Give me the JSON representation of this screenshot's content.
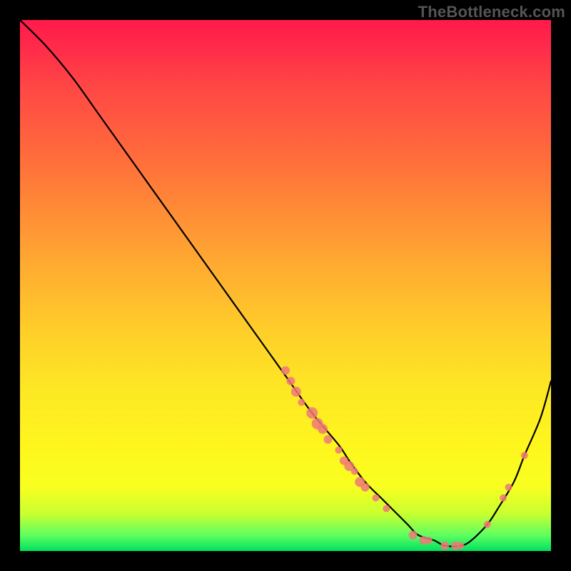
{
  "watermark": "TheBottleneck.com",
  "colors": {
    "background": "#000000",
    "gradient_top": "#ff1a4a",
    "gradient_bottom": "#00e060",
    "curve": "#000000",
    "dots": "#f07878"
  },
  "chart_data": {
    "type": "line",
    "title": "",
    "xlabel": "",
    "ylabel": "",
    "xlim": [
      0,
      100
    ],
    "ylim": [
      0,
      100
    ],
    "series": [
      {
        "name": "curve",
        "x": [
          0,
          5,
          10,
          15,
          20,
          25,
          30,
          35,
          40,
          45,
          50,
          55,
          60,
          62,
          65,
          68,
          70,
          73,
          75,
          78,
          80,
          83,
          85,
          88,
          90,
          93,
          95,
          98,
          100
        ],
        "y": [
          100,
          95,
          89,
          82,
          75,
          68,
          61,
          54,
          47,
          40,
          33,
          26,
          20,
          17,
          13,
          10,
          8,
          5,
          3,
          2,
          1,
          1,
          2,
          5,
          8,
          13,
          18,
          25,
          32
        ]
      }
    ],
    "scatter": [
      {
        "name": "dots",
        "points": [
          {
            "x": 50,
            "y": 34,
            "r": 6
          },
          {
            "x": 51,
            "y": 32,
            "r": 6
          },
          {
            "x": 52,
            "y": 30,
            "r": 7
          },
          {
            "x": 53,
            "y": 28,
            "r": 5
          },
          {
            "x": 55,
            "y": 26,
            "r": 8
          },
          {
            "x": 56,
            "y": 24,
            "r": 8
          },
          {
            "x": 57,
            "y": 23,
            "r": 7
          },
          {
            "x": 58,
            "y": 21,
            "r": 6
          },
          {
            "x": 60,
            "y": 19,
            "r": 5
          },
          {
            "x": 61,
            "y": 17,
            "r": 6
          },
          {
            "x": 62,
            "y": 16,
            "r": 7
          },
          {
            "x": 63,
            "y": 15,
            "r": 5
          },
          {
            "x": 64,
            "y": 13,
            "r": 7
          },
          {
            "x": 65,
            "y": 12,
            "r": 6
          },
          {
            "x": 67,
            "y": 10,
            "r": 5
          },
          {
            "x": 69,
            "y": 8,
            "r": 5
          },
          {
            "x": 74,
            "y": 3,
            "r": 6
          },
          {
            "x": 76,
            "y": 2,
            "r": 6
          },
          {
            "x": 77,
            "y": 2,
            "r": 5
          },
          {
            "x": 80,
            "y": 1,
            "r": 6
          },
          {
            "x": 82,
            "y": 1,
            "r": 6
          },
          {
            "x": 83,
            "y": 1,
            "r": 5
          },
          {
            "x": 88,
            "y": 5,
            "r": 5
          },
          {
            "x": 91,
            "y": 10,
            "r": 5
          },
          {
            "x": 92,
            "y": 12,
            "r": 5
          },
          {
            "x": 95,
            "y": 18,
            "r": 5
          }
        ]
      }
    ]
  }
}
